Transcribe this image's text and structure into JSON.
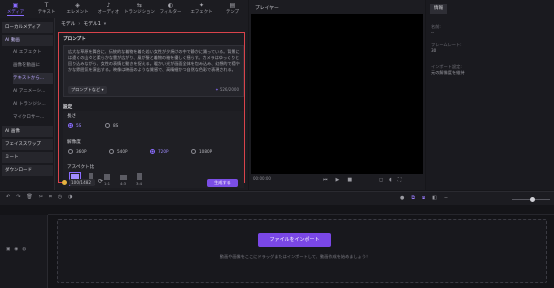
{
  "toolbar": {
    "items": [
      {
        "icon": "media-icon",
        "label": "メディア",
        "active": true
      },
      {
        "icon": "text-icon",
        "label": "テキスト"
      },
      {
        "icon": "element-icon",
        "label": "エレメント"
      },
      {
        "icon": "audio-icon",
        "label": "オーディオ"
      },
      {
        "icon": "transition-icon",
        "label": "トランジション"
      },
      {
        "icon": "filter-icon",
        "label": "フィルター"
      },
      {
        "icon": "effect-icon",
        "label": "エフェクト"
      },
      {
        "icon": "template-icon",
        "label": "テンプ"
      }
    ]
  },
  "sidebar": {
    "items": [
      {
        "label": "ローカルメディア",
        "type": "sub"
      },
      {
        "label": "AI 動画",
        "type": "group"
      },
      {
        "label": "AI エフェクト",
        "type": "sub"
      },
      {
        "label": "画像を動画に",
        "type": "sub"
      },
      {
        "label": "テキストから...",
        "type": "sub",
        "active": true
      },
      {
        "label": "AI アニメーシ...",
        "type": "sub"
      },
      {
        "label": "AI トランジシ...",
        "type": "sub"
      },
      {
        "label": "マイクロサー...",
        "type": "sub"
      },
      {
        "label": "AI 画像",
        "type": "group"
      },
      {
        "label": "フェイススワップ",
        "type": "group"
      },
      {
        "label": "ミート",
        "type": "group"
      },
      {
        "label": "ダウンロード",
        "type": "group"
      }
    ]
  },
  "panel": {
    "breadcrumb": [
      "モデル",
      "モデル1"
    ],
    "prompt_label": "プロンプト",
    "prompt_text": "広大な草原を舞台に、伝統的な着物を着た若い女性が夕焼けの中で静かに踊っている。背景には遠くの山々と柔らかな雲が広がり、風が髪と着物の袖を優しく揺らす。カメラはゆっくりと回り込みながら、女性の表情と動きを捉える。暖かい光が画面全体を包み込み、幻想的で穏やかな雰囲気を演出する。映像は映画のような質感で、高精細かつ自然な色彩で表現される。",
    "prompt_dropdown": "プロンプトなど",
    "char_count": "526/2000",
    "settings_label": "設定",
    "length_label": "長さ",
    "length_options": [
      {
        "label": "5S",
        "selected": true
      },
      {
        "label": "8S",
        "selected": false
      }
    ],
    "resolution_label": "解像度",
    "resolution_options": [
      {
        "label": "360P",
        "selected": false
      },
      {
        "label": "540P",
        "selected": false
      },
      {
        "label": "720P",
        "selected": true
      },
      {
        "label": "1080P",
        "selected": false
      }
    ],
    "aspect_label": "アスペクト比",
    "aspect_options": [
      {
        "label": "16:9",
        "selected": true
      },
      {
        "label": "9:16",
        "selected": false
      },
      {
        "label": "1:1",
        "selected": false
      },
      {
        "label": "4:3",
        "selected": false
      },
      {
        "label": "3:4",
        "selected": false
      }
    ],
    "credits": "100/1482",
    "generate_label": "生成する"
  },
  "player": {
    "title": "プレイヤー",
    "time": "00:00:00"
  },
  "properties": {
    "tab": "情報",
    "fields": [
      {
        "name": "名前:",
        "value": "--"
      },
      {
        "name": "フレームレート:",
        "value": "30"
      },
      {
        "name": "インポート設定:",
        "value": "元の解像度を維持"
      }
    ]
  },
  "timeline": {
    "import_button": "ファイルをインポート",
    "hint": "動画や画像をここにドラッグまたはインポートして、動画作成を始めましょう！"
  }
}
